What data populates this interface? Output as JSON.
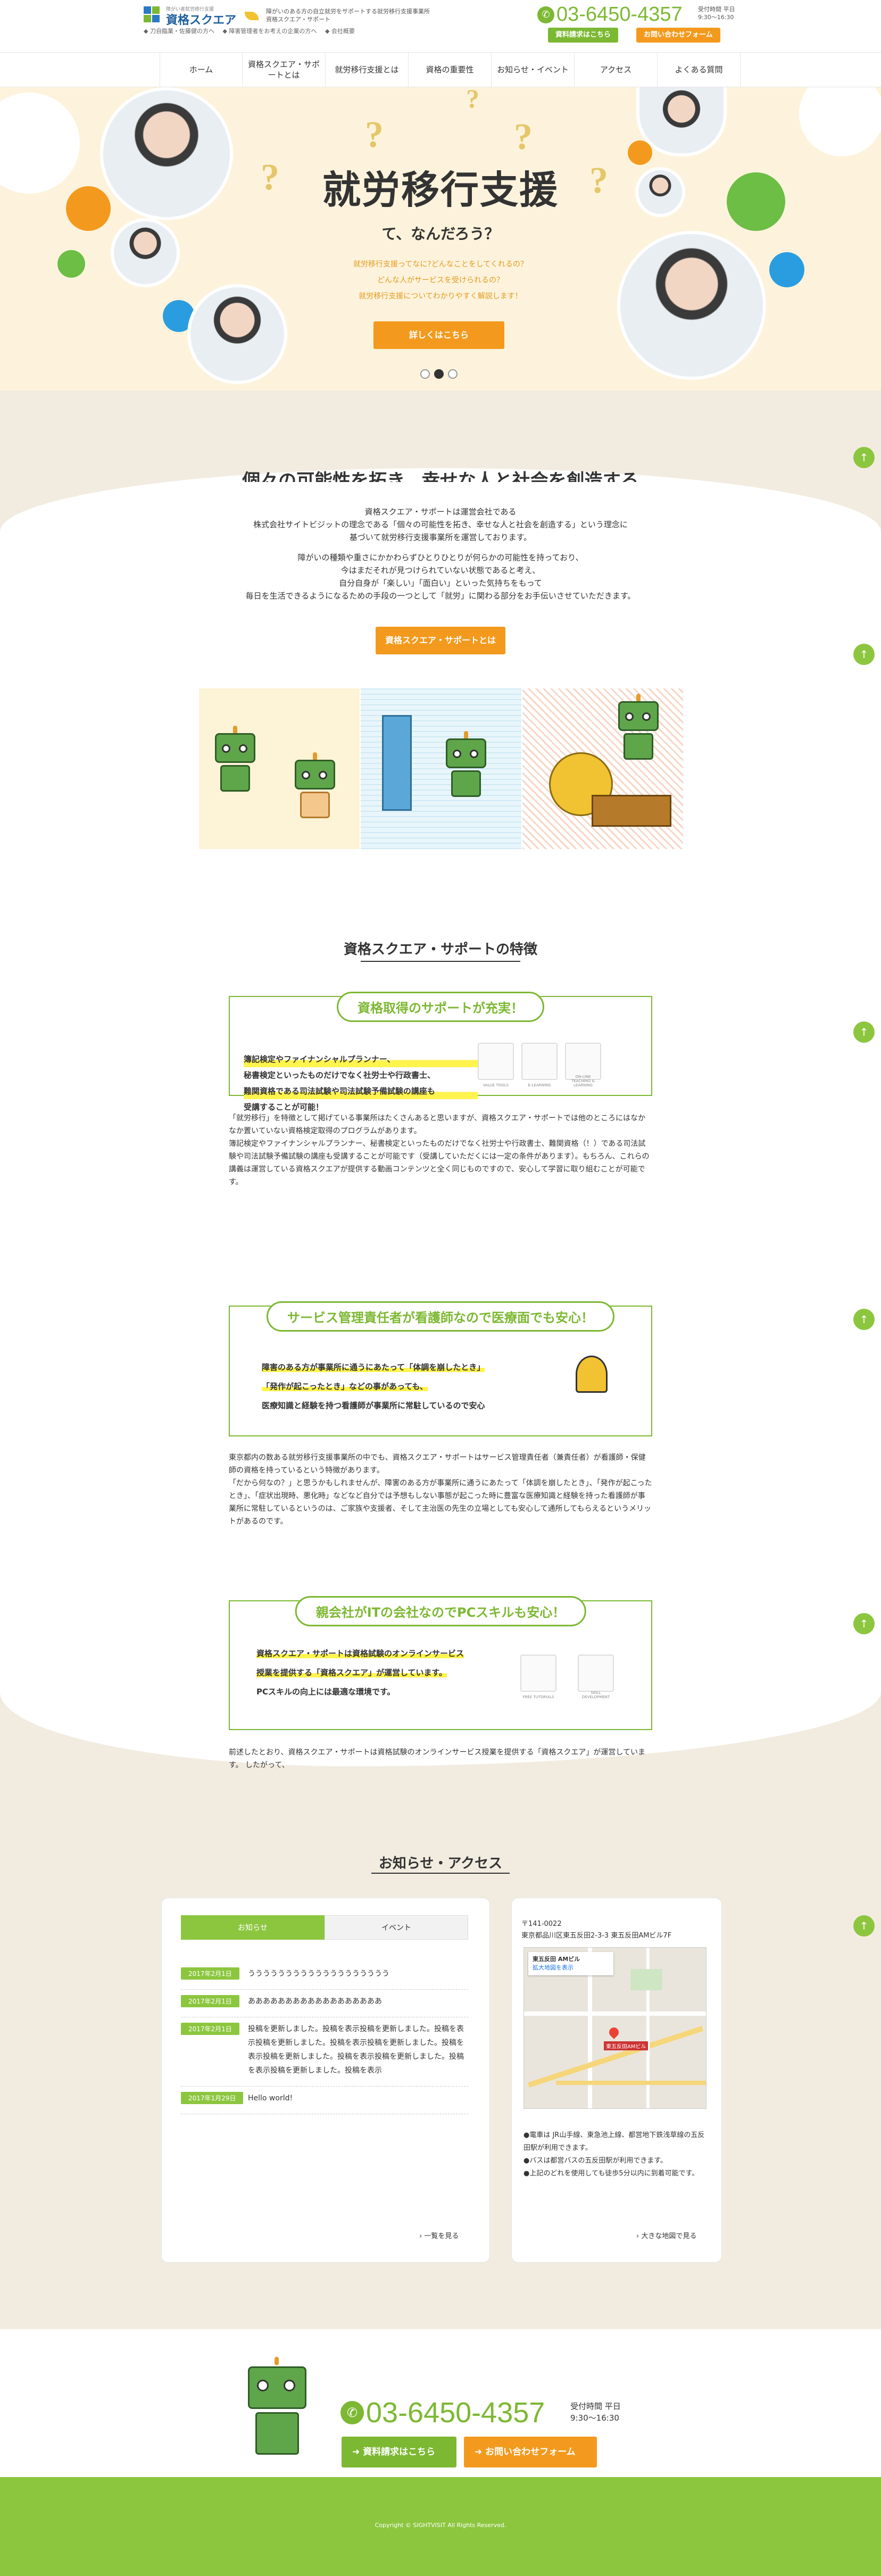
{
  "header": {
    "logo_sub": "障がい者就労移行支援",
    "logo_text": "資格スクエア",
    "tagline": "障がいのある方の自立就労をサポートする就労移行支援事業所 資格スクエア・サポート",
    "sublinks": [
      "◆ 刀自臨業・佐藤健の方へ",
      "◆ 障害管理者をお考えの企業の方へ",
      "◆ 会社概要"
    ],
    "phone": "03-6450-4357",
    "hours_label": "受付時間 平日",
    "hours": "9:30〜16:30",
    "doc_button": "資料請求はこちら",
    "form_button": "お問い合わせフォーム"
  },
  "nav": {
    "items": [
      "ホーム",
      "資格スクエア・サポートとは",
      "就労移行支援とは",
      "資格の重要性",
      "お知らせ・イベント",
      "アクセス",
      "よくある質問"
    ]
  },
  "hero": {
    "title": "就労移行支援",
    "subtitle": "て、なんだろう？",
    "questions": [
      "就労移行支援ってなに?どんなことをしてくれるの？",
      "どんな人がサービスを受けられるの？",
      "就労移行支援についてわかりやすく解説します！"
    ],
    "button": "詳しくはこちら"
  },
  "about": {
    "heading": "個々の可能性を拓き、幸せな人と社会を創造する",
    "paragraphs": [
      [
        "資格スクエア・サポートは運営会社である",
        "株式会社サイトビジットの理念である「個々の可能性を拓き、幸せな人と社会を創造する」という理念に",
        "基づいて就労移行支援事業所を運営しております。"
      ],
      [
        "障がいの種類や重さにかかわらずひとりひとりが何らかの可能性を持っており、",
        "今はまだそれが見つけられていない状態であると考え、",
        "自分自身が「楽しい」「面白い」といった気持ちをもって",
        "毎日を生活できるようになるための手段の一つとして「就労」に関わる部分をお手伝いさせていただきます。"
      ]
    ],
    "button": "資格スクエア・サポートとは"
  },
  "features": {
    "heading": "資格スクエア・サポートの特徴",
    "items": [
      {
        "pill": "資格取得のサポートが充実！",
        "lines": [
          "簿記検定やファイナンシャルプランナー、",
          "秘書検定といったものだけでなく社労士や行政書士、",
          "難関資格である司法試験や司法試験予備試験の講座も",
          "受講することが可能！"
        ],
        "icons": [
          "VALUE TOOLS",
          "E-LEARNING",
          "ON-LINE TEACHING & LEARNING"
        ],
        "body": [
          "「就労移行」を特徴として掲げている事業所はたくさんあると思いますが、資格スクエア・サポートでは他のところにはなかなか置いていない資格検定取得のプログラムがあります。",
          "簿記検定やファイナンシャルプランナー、秘書検定といったものだけでなく社労士や行政書士、難関資格（！）である司法試験や司法試験予備試験の講座も受講することが可能です（受講していただくには一定の条件があります）。もちろん、これらの講義は運営している資格スクエアが提供する動画コンテンツと全く同じものですので、安心して学習に取り組むことが可能です。"
        ]
      },
      {
        "pill": "サービス管理責任者が看護師なので医療面でも安心！",
        "lines": [
          "障害のある方が事業所に通うにあたって「体調を崩したとき」",
          "「発作が起こったとき」などの事があっても、",
          "医療知識と経験を持つ看護師が事業所に常駐しているので安心"
        ],
        "body": [
          "東京都内の数ある就労移行支援事業所の中でも、資格スクエア・サポートはサービス管理責任者（兼責任者）が看護師・保健師の資格を持っているという特徴があります。",
          "「だから何なの？」と思うかもしれませんが、障害のある方が事業所に通うにあたって「体調を崩したとき」、「発作が起こったとき」、「症状出現時、悪化時」などなど自分では予想もしない事態が起こった時に豊富な医療知識と経験を持った看護師が事業所に常駐しているというのは、ご家族や支援者、そして主治医の先生の立場としても安心して通所してもらえるというメリットがあるのです。"
        ]
      },
      {
        "pill": "親会社がITの会社なのでPCスキルも安心！",
        "lines": [
          "資格スクエア・サポートは資格試験のオンラインサービス",
          "授業を提供する「資格スクエア」が運営しています。",
          "PCスキルの向上には最適な環境です。"
        ],
        "icons": [
          "FREE TUTORIALS",
          "SKILL DEVELOPMENT"
        ],
        "body": [
          "前述したとおり、資格スクエア・サポートは資格試験のオンラインサービス授業を提供する「資格スクエア」が運営しています。 したがって、"
        ]
      }
    ]
  },
  "news_access": {
    "heading": "お知らせ・アクセス",
    "tabs": [
      "お知らせ",
      "イベント"
    ],
    "news": [
      {
        "date": "2017年2月1日",
        "title": "ううううううううううううううううううう"
      },
      {
        "date": "2017年2月1日",
        "title": "ああああああああああああああああああ"
      },
      {
        "date": "2017年2月1日",
        "title": "投稿を更新しました。投稿を表示投稿を更新しました。投稿を表示投稿を更新しました。投稿を表示投稿を更新しました。投稿を表示投稿を更新しました。投稿を表示投稿を更新しました。投稿を表示投稿を更新しました。投稿を表示"
      },
      {
        "date": "2017年1月29日",
        "title": "Hello world!"
      }
    ],
    "news_more": "一覧を見る",
    "postal": "〒141-0022",
    "address": "東京都品川区東五反田2-3-3 東五反田AMビル7F",
    "map_place": "東五反田 AMビル",
    "map_link": "拡大地図を表示",
    "map_pin_label": "東五反田AMビル",
    "notes": [
      "●電車は JR山手線、東急池上線、都営地下鉄浅草線の五反田駅が利用できます。",
      "●バスは都営バスの五反田駅が利用できます。",
      "●上記のどれを使用しても徒歩5分以内に到着可能です。"
    ],
    "map_more": "大きな地図で見る"
  },
  "cta": {
    "phone": "03-6450-4357",
    "hours_label": "受付時間 平日",
    "hours": "9:30〜16:30",
    "doc_button": "資料請求はこちら",
    "form_button": "お問い合わせフォーム"
  },
  "footer": {
    "copyright": "Copyright © SIGHTVISIT All Rights Reserved."
  }
}
